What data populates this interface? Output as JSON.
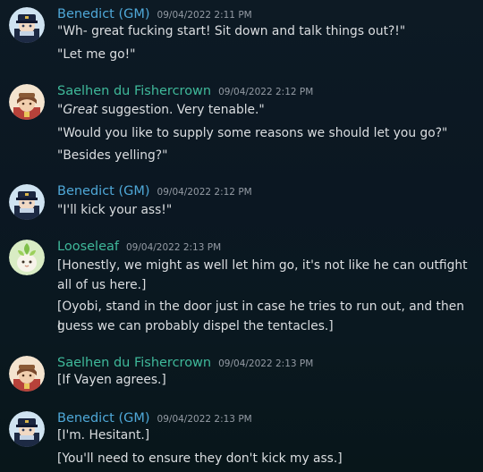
{
  "messages": [
    {
      "author": "Benedict (GM)",
      "avatar": "benedict-avatar",
      "time": "09/04/2022 2:11 PM",
      "lines": [
        "\"Wh- great fucking start! Sit down and talk things out?!\"",
        "\"Let me go!\""
      ]
    },
    {
      "author": "Saelhen du Fishercrown",
      "avatar": "saelhen-avatar",
      "time": "09/04/2022 2:12 PM",
      "lines": [
        "suggestion. Very tenable.\"",
        "\"Would you like to supply some reasons we should let you go?\"",
        "\"Besides yelling?\""
      ],
      "emphasis": "\"Great"
    },
    {
      "author": "Benedict (GM)",
      "avatar": "benedict-avatar",
      "time": "09/04/2022 2:12 PM",
      "lines": [
        "\"I'll kick your ass!\""
      ]
    },
    {
      "author": "Looseleaf",
      "avatar": "looseleaf-avatar",
      "time": "09/04/2022 2:13 PM",
      "lines": [
        "[Honestly, we might as well let him go, it's not like he can outfight",
        "all of us here.]",
        "[Oyobi, stand in the door just in case he tries to run out, and then I",
        "guess we can probably dispel the tentacles.]"
      ]
    },
    {
      "author": "Saelhen du Fishercrown",
      "avatar": "saelhen-avatar",
      "time": "09/04/2022 2:13 PM",
      "lines": [
        "[If Vayen agrees.]"
      ]
    },
    {
      "author": "Benedict (GM)",
      "avatar": "benedict-avatar",
      "time": "09/04/2022 2:13 PM",
      "lines": [
        "[I'm. Hesitant.]",
        "[You'll need to ensure they don't kick my ass.]"
      ]
    }
  ],
  "colors": {
    "benedict": "#4fa8d8",
    "saelhen": "#3fb99a",
    "looseleaf": "#3fb99a",
    "text": "#dbdee1",
    "timestamp": "#949ba4"
  }
}
